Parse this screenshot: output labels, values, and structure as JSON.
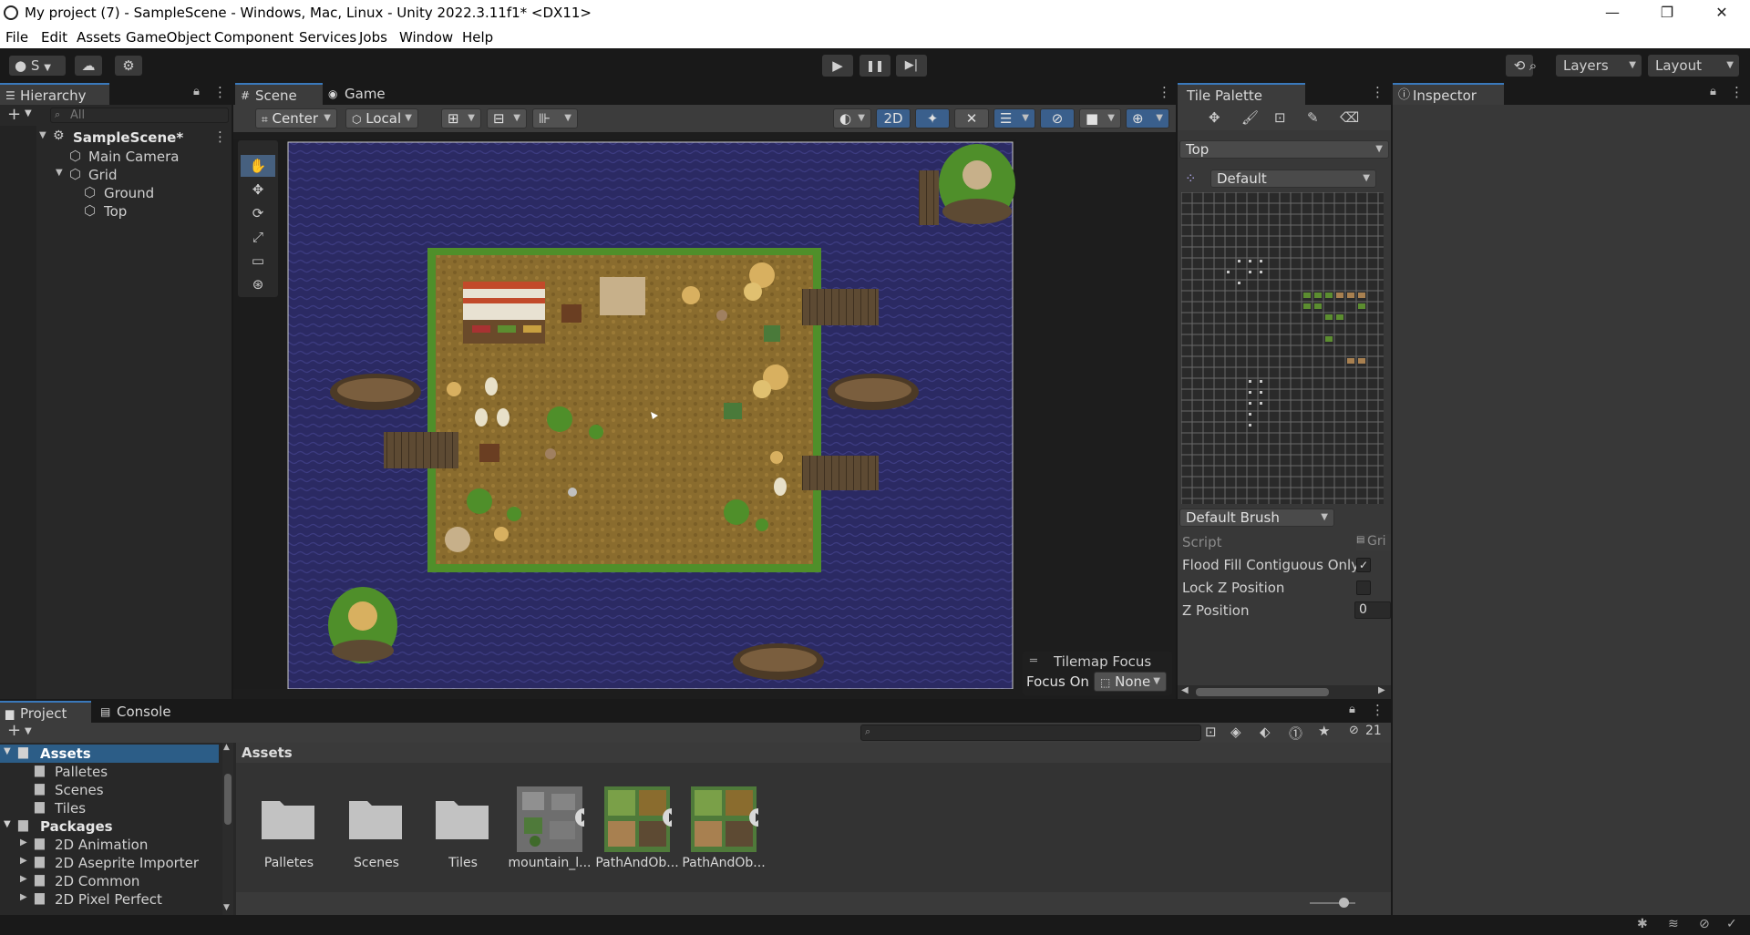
{
  "window": {
    "title": "My project (7) - SampleScene - Windows, Mac, Linux - Unity 2022.3.11f1* <DX11>",
    "minimize": "—",
    "maximize": "❐",
    "close": "✕"
  },
  "menu": [
    "File",
    "Edit",
    "Assets",
    "GameObject",
    "Component",
    "Services",
    "Jobs",
    "Window",
    "Help"
  ],
  "toolbar": {
    "account_label": "S",
    "layers_label": "Layers",
    "layout_label": "Layout"
  },
  "hierarchy": {
    "tab": "Hierarchy",
    "search_placeholder": "All",
    "scene_name": "SampleScene*",
    "items": [
      {
        "label": "Main Camera"
      },
      {
        "label": "Grid"
      },
      {
        "label": "Ground"
      },
      {
        "label": "Top"
      }
    ]
  },
  "scene": {
    "tabs": [
      "Scene",
      "Game"
    ],
    "pivot_label": "Center",
    "space_label": "Local",
    "mode_2d": "2D",
    "tilemap_focus": {
      "title": "Tilemap Focus",
      "focus_on_label": "Focus On",
      "focus_value": "None"
    }
  },
  "tile_palette": {
    "tab": "Tile Palette",
    "active_tilemap": "Top",
    "palette": "Default",
    "brush": "Default Brush",
    "properties": [
      {
        "label": "Script",
        "value": "Gri"
      },
      {
        "label": "Flood Fill Contiguous Only",
        "value": "✓"
      },
      {
        "label": "Lock Z Position",
        "value": ""
      },
      {
        "label": "Z Position",
        "value": "0"
      }
    ]
  },
  "inspector": {
    "tab": "Inspector"
  },
  "project": {
    "tabs": [
      "Project",
      "Console"
    ],
    "hidden_count": "21",
    "tree": [
      {
        "label": "Assets"
      },
      {
        "label": "Palletes"
      },
      {
        "label": "Scenes"
      },
      {
        "label": "Tiles"
      },
      {
        "label": "Packages"
      },
      {
        "label": "2D Animation"
      },
      {
        "label": "2D Aseprite Importer"
      },
      {
        "label": "2D Common"
      },
      {
        "label": "2D Pixel Perfect"
      }
    ],
    "breadcrumb": "Assets",
    "assets": [
      {
        "label": "Palletes",
        "type": "folder"
      },
      {
        "label": "Scenes",
        "type": "folder"
      },
      {
        "label": "Tiles",
        "type": "folder"
      },
      {
        "label": "mountain_l...",
        "type": "texture"
      },
      {
        "label": "PathAndOb...",
        "type": "texture"
      },
      {
        "label": "PathAndOb...",
        "type": "texture"
      }
    ]
  },
  "colors": {
    "accent": "#3a79bb",
    "water": "#2b2a63",
    "ground": "#8a6c2e",
    "grass": "#4f8f2a"
  }
}
